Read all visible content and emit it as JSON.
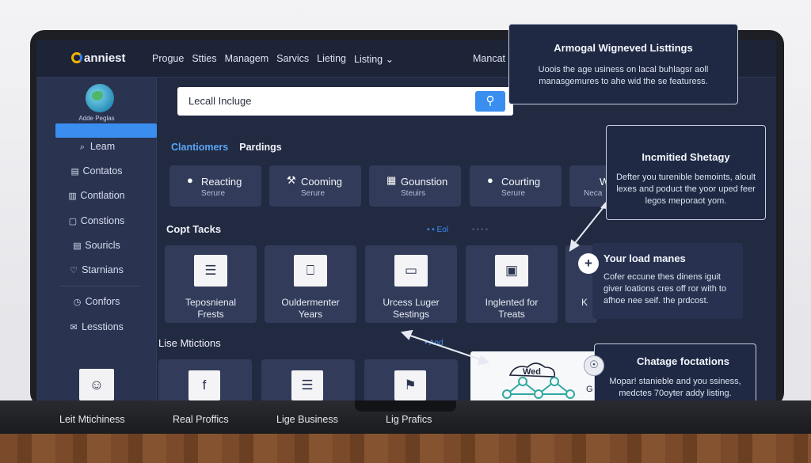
{
  "header": {
    "logo_text": "anniest",
    "nav": [
      "Progue",
      "Stties",
      "Managem",
      "Sarvics",
      "Lieting",
      "Listing ⌄"
    ],
    "right_link": "Mancat"
  },
  "sidebar": {
    "caption": "Adde Peglas",
    "items": [
      {
        "label": "Leam",
        "icon": "search-icon",
        "glyph": "⌕"
      },
      {
        "label": "Contatos",
        "icon": "contacts-icon",
        "glyph": "▤"
      },
      {
        "label": "Contlation",
        "icon": "list-icon",
        "glyph": "▥"
      },
      {
        "label": "Constions",
        "icon": "chat-icon",
        "glyph": "▢"
      },
      {
        "label": "Souricls",
        "icon": "document-icon",
        "glyph": "▤"
      },
      {
        "label": "Starnians",
        "icon": "location-icon",
        "glyph": "♡"
      },
      {
        "label": "Confors",
        "icon": "clock-icon",
        "glyph": "◷"
      },
      {
        "label": "Lesstions",
        "icon": "mail-icon",
        "glyph": "✉"
      }
    ]
  },
  "search": {
    "value": "Lecall Incluge",
    "button_icon": "search-icon"
  },
  "tabs": {
    "active": "Clantiomers",
    "other": "Pardings"
  },
  "categories": [
    {
      "title": "Reacting",
      "subtitle": "Serure",
      "icon": "pin-icon",
      "glyph": "●"
    },
    {
      "title": "Cooming",
      "subtitle": "Serure",
      "icon": "wrench-icon",
      "glyph": "⚒"
    },
    {
      "title": "Gounstion",
      "subtitle": "Steuirs",
      "icon": "building-icon",
      "glyph": "▦"
    },
    {
      "title": "Courting",
      "subtitle": "Serure",
      "icon": "pin-icon",
      "glyph": "●"
    },
    {
      "title": "W",
      "subtitle": "Neca",
      "icon": "grid-icon",
      "glyph": ""
    }
  ],
  "tools_section": {
    "title": "Copt Tacks",
    "link": "• • Eol",
    "dots": "••••",
    "cards": [
      {
        "line1": "Teposnienal",
        "line2": "Frests",
        "icon": "form-icon",
        "glyph": "☰"
      },
      {
        "line1": "Ouldermenter",
        "line2": "Years",
        "icon": "inbox-icon",
        "glyph": "⎕"
      },
      {
        "line1": "Urcess Luger",
        "line2": "Sestings",
        "icon": "card-icon",
        "glyph": "▭"
      },
      {
        "line1": "Inglented for",
        "line2": "Treats",
        "icon": "laptop-icon",
        "glyph": "▣"
      },
      {
        "line1": "K",
        "line2": "",
        "icon": "plus-icon",
        "glyph": "+"
      }
    ]
  },
  "listings_section": {
    "title": "Lise Mtictions",
    "link": "• Aod",
    "cards": [
      {
        "icon": "facebook-icon",
        "glyph": "f"
      },
      {
        "icon": "document-icon",
        "glyph": "☰"
      },
      {
        "icon": "flag-icon",
        "glyph": "⚑"
      }
    ],
    "wed_label": "Wed",
    "wed_suffix": "G"
  },
  "callouts": {
    "top": {
      "title": "Armogal Wigneved Listtings",
      "body": "Uoois the age usiness on lacal buhlagsr aoll manasgemures to ahe wid the se featuress."
    },
    "middle": {
      "title": "Incmitied Shetagy",
      "body": "Defter you turenible bemoints, aloult lexes and poduct the yoor uped feer legos meporaot yom."
    },
    "plus": {
      "title": "Your load manes",
      "body": "Cofer eccune thes dinens iguit giver loations cres off ror with to afhoe nee seif. the prdcost."
    },
    "bottom": {
      "title": "Chatage foctations",
      "body": "Mopar! stanieble and you ssiness, medctes 70oyter addy listing."
    }
  },
  "bottom_bar": [
    "Leit Mtichiness",
    "Real Proffics",
    "Lige Business",
    "Lig Prafics"
  ]
}
